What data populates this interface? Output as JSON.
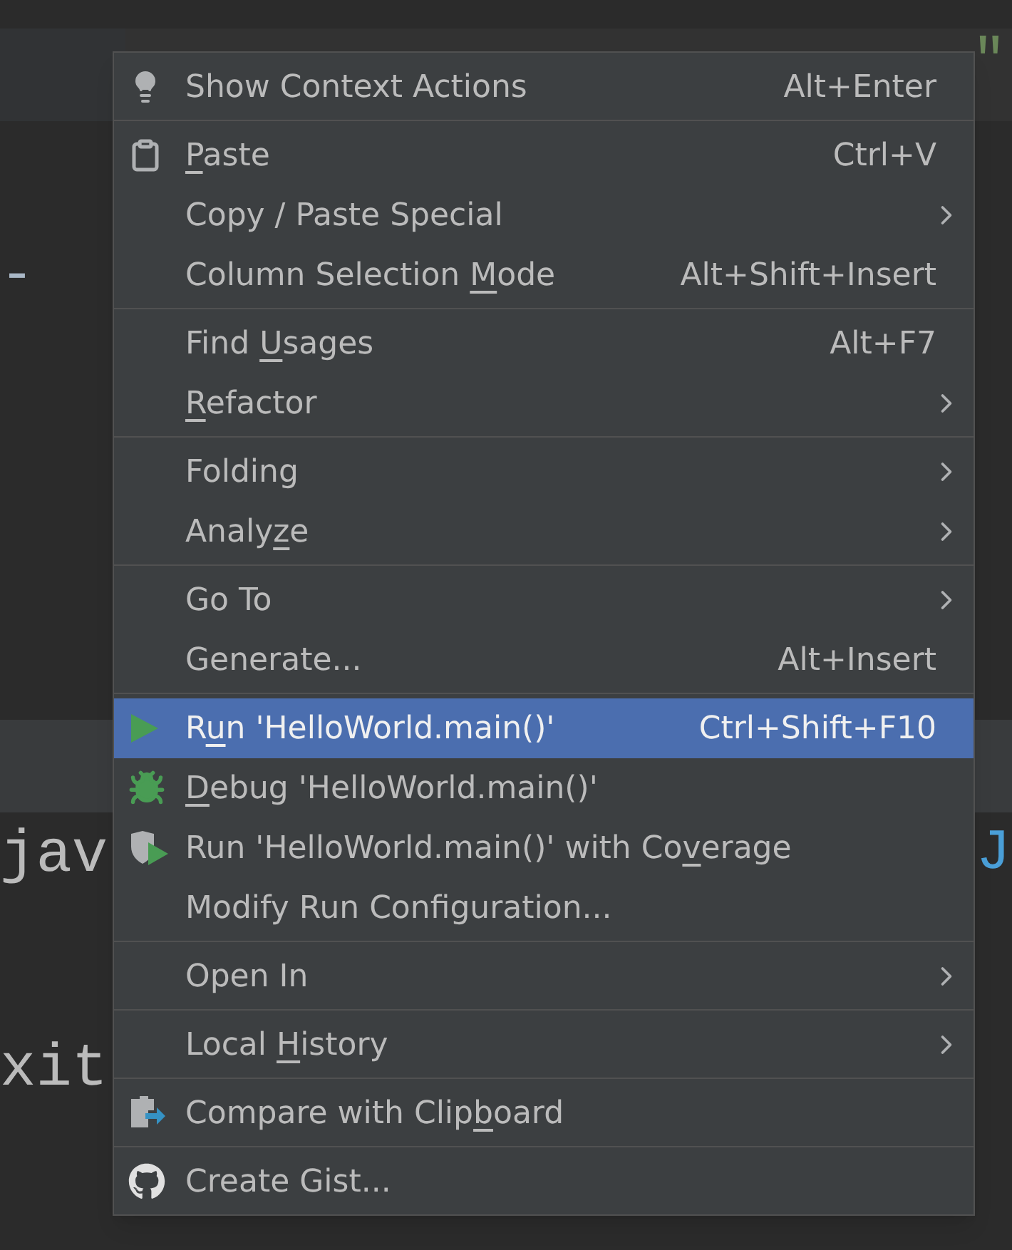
{
  "editor": {
    "top_code": "\"",
    "line_a": "-",
    "line_b": "jav",
    "line_b_right": "J",
    "line_c": "xit"
  },
  "context_menu": {
    "groups": [
      {
        "items": [
          {
            "kind": "bulb",
            "label": {
              "before": "Show Context Actions"
            },
            "shortcut": "Alt+Enter",
            "submenu": false,
            "selected": false
          }
        ]
      },
      {
        "items": [
          {
            "kind": "clipboard",
            "label": {
              "key": "P",
              "after": "aste"
            },
            "shortcut": "Ctrl+V",
            "submenu": false,
            "selected": false
          },
          {
            "kind": "plain",
            "label": {
              "before": "Copy / Paste Special"
            },
            "submenu": true,
            "selected": false
          },
          {
            "kind": "plain",
            "label": {
              "before": "Column Selection ",
              "key": "M",
              "after": "ode"
            },
            "shortcut": "Alt+Shift+Insert",
            "submenu": false,
            "selected": false
          }
        ]
      },
      {
        "items": [
          {
            "kind": "plain",
            "label": {
              "before": "Find ",
              "key": "U",
              "after": "sages"
            },
            "shortcut": "Alt+F7",
            "submenu": false,
            "selected": false
          },
          {
            "kind": "plain",
            "label": {
              "key": "R",
              "after": "efactor"
            },
            "submenu": true,
            "selected": false
          }
        ]
      },
      {
        "items": [
          {
            "kind": "plain",
            "label": {
              "before": "Folding"
            },
            "submenu": true,
            "selected": false
          },
          {
            "kind": "plain",
            "label": {
              "before": "Analy",
              "key": "z",
              "after": "e"
            },
            "submenu": true,
            "selected": false
          }
        ]
      },
      {
        "items": [
          {
            "kind": "plain",
            "label": {
              "before": "Go To"
            },
            "submenu": true,
            "selected": false
          },
          {
            "kind": "plain",
            "label": {
              "before": "Generate..."
            },
            "shortcut": "Alt+Insert",
            "submenu": false,
            "selected": false
          }
        ]
      },
      {
        "items": [
          {
            "kind": "play",
            "label": {
              "before": "R",
              "key": "u",
              "after": "n 'HelloWorld.main()'"
            },
            "shortcut": "Ctrl+Shift+F10",
            "submenu": false,
            "selected": true
          },
          {
            "kind": "bug",
            "label": {
              "key": "D",
              "after": "ebug 'HelloWorld.main()'"
            },
            "submenu": false,
            "selected": false
          },
          {
            "kind": "coverage",
            "label": {
              "before": "Run 'HelloWorld.main()' with Co",
              "key": "v",
              "after": "erage"
            },
            "submenu": false,
            "selected": false
          },
          {
            "kind": "plain",
            "label": {
              "before": "Modify Run Configuration..."
            },
            "submenu": false,
            "selected": false
          }
        ]
      },
      {
        "items": [
          {
            "kind": "plain",
            "label": {
              "before": "Open In"
            },
            "submenu": true,
            "selected": false
          }
        ]
      },
      {
        "items": [
          {
            "kind": "plain",
            "label": {
              "before": "Local ",
              "key": "H",
              "after": "istory"
            },
            "submenu": true,
            "selected": false
          }
        ]
      },
      {
        "items": [
          {
            "kind": "compare",
            "label": {
              "before": "Compare with Clip",
              "key": "b",
              "after": "oard"
            },
            "submenu": false,
            "selected": false
          }
        ]
      },
      {
        "items": [
          {
            "kind": "github",
            "label": {
              "before": "Create Gist..."
            },
            "submenu": false,
            "selected": false
          }
        ]
      }
    ]
  }
}
